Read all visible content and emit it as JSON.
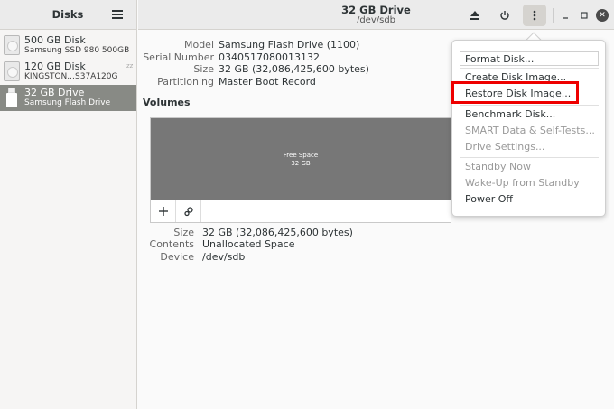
{
  "sidebar": {
    "title": "Disks",
    "disks": [
      {
        "name": "500 GB Disk",
        "sub": "Samsung SSD 980 500GB",
        "extra": ""
      },
      {
        "name": "120 GB Disk",
        "sub": "KINGSTON...",
        "extra": "S37A120G"
      },
      {
        "name": "32 GB Drive",
        "sub": "Samsung Flash Drive",
        "extra": ""
      }
    ]
  },
  "header": {
    "title": "32 GB Drive",
    "subtitle": "/dev/sdb"
  },
  "drive": {
    "model_label": "Model",
    "model": "Samsung Flash Drive (1100)",
    "serial_label": "Serial Number",
    "serial": "0340517080013132",
    "size_label": "Size",
    "size": "32 GB (32,086,425,600 bytes)",
    "partitioning_label": "Partitioning",
    "partitioning": "Master Boot Record"
  },
  "volumes": {
    "title": "Volumes",
    "free_space_label": "Free Space",
    "free_space_size": "32 GB"
  },
  "volume_info": {
    "size_label": "Size",
    "size": "32 GB (32,086,425,600 bytes)",
    "contents_label": "Contents",
    "contents": "Unallocated Space",
    "device_label": "Device",
    "device": "/dev/sdb"
  },
  "menu": {
    "items": [
      {
        "label": "Format Disk...",
        "enabled": true
      },
      {
        "label": "Create Disk Image...",
        "enabled": true
      },
      {
        "label": "Restore Disk Image...",
        "enabled": true
      },
      {
        "label": "Benchmark Disk...",
        "enabled": true
      },
      {
        "label": "SMART Data & Self-Tests...",
        "enabled": false
      },
      {
        "label": "Drive Settings...",
        "enabled": false
      },
      {
        "label": "Standby Now",
        "enabled": false
      },
      {
        "label": "Wake-Up from Standby",
        "enabled": false
      },
      {
        "label": "Power Off",
        "enabled": true
      }
    ]
  },
  "icons": {
    "eject": "eject-icon",
    "power": "power-icon",
    "menu": "vertical-dots-icon",
    "minimize": "minimize-icon",
    "maximize": "maximize-icon",
    "close": "close-icon"
  },
  "colors": {
    "highlight": "#ee0000",
    "selected": "#888a85",
    "volume_bar": "#777777"
  }
}
